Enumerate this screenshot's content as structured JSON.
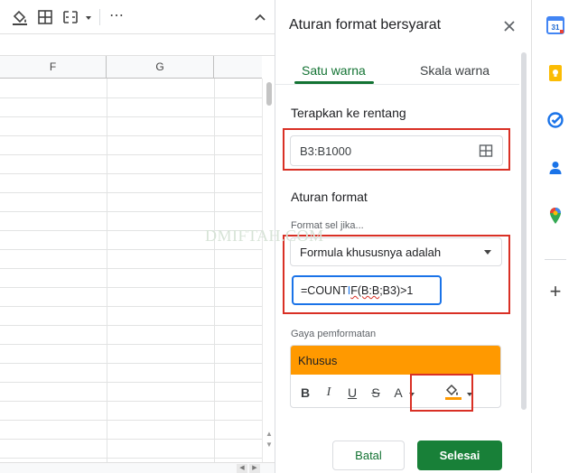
{
  "sheet": {
    "columns": [
      "F",
      "G"
    ],
    "toolbar_icons": [
      "fill-color-icon",
      "borders-icon",
      "merge-cells-icon",
      "more-icon",
      "collapse-icon"
    ],
    "more_label": "⋯"
  },
  "panel": {
    "title": "Aturan format bersyarat",
    "tabs": [
      {
        "label": "Satu warna",
        "active": true
      },
      {
        "label": "Skala warna",
        "active": false
      }
    ],
    "apply_range": {
      "title": "Terapkan ke rentang",
      "value": "B3:B1000"
    },
    "rules": {
      "title": "Aturan format",
      "condition_label": "Format sel jika...",
      "condition_value": "Formula khususnya adalah",
      "formula_before": "=COUNT",
      "formula_cursor": "I",
      "formula_squiggle": "F(B:B",
      "formula_after": ";B3)>1"
    },
    "style": {
      "label": "Gaya pemformatan",
      "preview_text": "Khusus",
      "preview_color": "#ff9900",
      "buttons": [
        "B",
        "I",
        "U",
        "S",
        "A"
      ]
    },
    "cancel_label": "Batal",
    "done_label": "Selesai"
  },
  "watermark": "DMIFTAH.COM",
  "colors": {
    "accent_green": "#188038",
    "highlight_red": "#d93025",
    "focus_blue": "#1a73e8"
  },
  "rail": {
    "icons": [
      "calendar-icon",
      "keep-icon",
      "tasks-icon",
      "contacts-icon",
      "maps-icon",
      "add-icon"
    ],
    "calendar_day": "31",
    "add_label": "+"
  }
}
